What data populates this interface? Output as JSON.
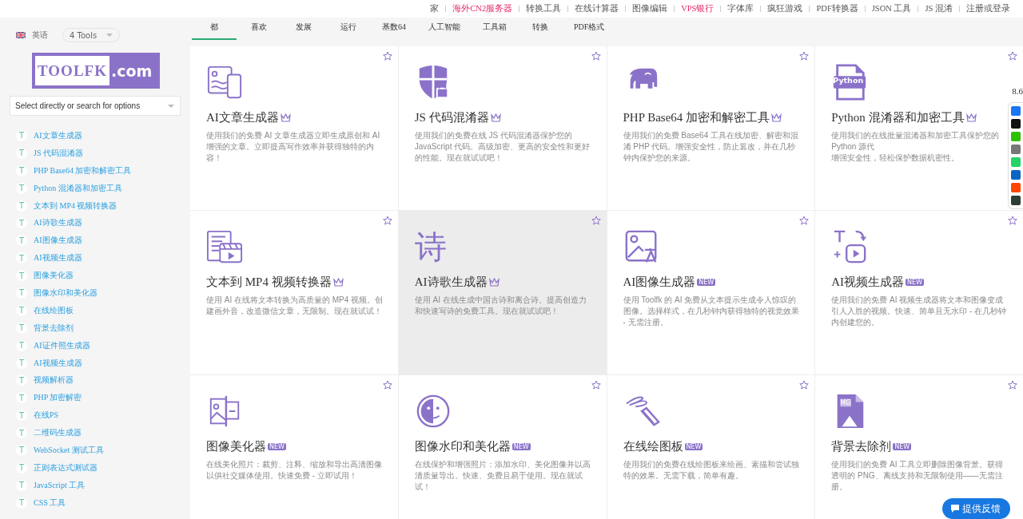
{
  "top_links": [
    {
      "label": "家",
      "highlight": false
    },
    {
      "label": "海外CN2服务器",
      "highlight": true
    },
    {
      "label": "转换工具",
      "highlight": false
    },
    {
      "label": "在线计算器",
      "highlight": false
    },
    {
      "label": "图像编辑",
      "highlight": false
    },
    {
      "label": "VPS银行",
      "highlight": true
    },
    {
      "label": "字体库",
      "highlight": false
    },
    {
      "label": "疯狂游戏",
      "highlight": false
    },
    {
      "label": "PDF转换器",
      "highlight": false
    },
    {
      "label": "JSON 工具",
      "highlight": false
    },
    {
      "label": "JS 混淆",
      "highlight": false
    },
    {
      "label": "注册或登录",
      "highlight": false
    }
  ],
  "sidebar": {
    "language": "英语",
    "tools_dropdown": "4 Tools",
    "logo": {
      "left": "TOOLFK",
      "right": ".com"
    },
    "search": {
      "placeholder": "Select directly or search for options"
    },
    "items": [
      {
        "mark": "T",
        "label": "AI文章生成器"
      },
      {
        "mark": "T",
        "label": "JS 代码混淆器"
      },
      {
        "mark": "T",
        "label": "PHP Base64 加密和解密工具"
      },
      {
        "mark": "T",
        "label": "Python 混淆器和加密工具"
      },
      {
        "mark": "T",
        "label": "文本到 MP4 视频转换器"
      },
      {
        "mark": "T",
        "label": "AI诗歌生成器"
      },
      {
        "mark": "T",
        "label": "AI图像生成器"
      },
      {
        "mark": "T",
        "label": "AI视频生成器"
      },
      {
        "mark": "T",
        "label": "图像美化器"
      },
      {
        "mark": "T",
        "label": "图像水印和美化器"
      },
      {
        "mark": "T",
        "label": "在线绘图板"
      },
      {
        "mark": "T",
        "label": "背景去除剂"
      },
      {
        "mark": "T",
        "label": "AI证件照生成器"
      },
      {
        "mark": "T",
        "label": "AI视频生成器"
      },
      {
        "mark": "T",
        "label": "视频解析器"
      },
      {
        "mark": "T",
        "label": "PHP 加密解密"
      },
      {
        "mark": "T",
        "label": "在线PS"
      },
      {
        "mark": "T",
        "label": "二维码生成器"
      },
      {
        "mark": "T",
        "label": "WebSocket 测试工具"
      },
      {
        "mark": "T",
        "label": "正则表达式测试器"
      },
      {
        "mark": "T",
        "label": "JavaScript 工具"
      },
      {
        "mark": "T",
        "label": "CSS 工具"
      }
    ]
  },
  "tabs": [
    {
      "label": "都",
      "selected": true
    },
    {
      "label": "喜欢",
      "selected": false
    },
    {
      "label": "发展",
      "selected": false
    },
    {
      "label": "运行",
      "selected": false
    },
    {
      "label": "基数64",
      "selected": false
    },
    {
      "label": "人工智能",
      "selected": false
    },
    {
      "label": "工具箱",
      "selected": false
    },
    {
      "label": "转换",
      "selected": false
    },
    {
      "label": "PDF格式",
      "selected": false
    }
  ],
  "cards": [
    {
      "title": "AI文章生成器",
      "badge": {
        "kind": "crown"
      },
      "description": "使用我们的免费 AI 文章生成器立即生成原创和 AI 增强的文章。立即提高写作效率并获得独特的内容！",
      "highlighted": false
    },
    {
      "title": "JS 代码混淆器",
      "badge": {
        "kind": "crown"
      },
      "description": "使用我们的免费在线 JS 代码混淆器保护您的 JavaScript 代码。高级加密、更高的安全性和更好的性能。现在就试试吧！",
      "highlighted": false
    },
    {
      "title": "PHP Base64 加密和解密工具",
      "badge": {
        "kind": "crown"
      },
      "description": "使用我们的免费 Base64 工具在线加密、解密和混淆 PHP 代码。增强安全性，防止篡改，并在几秒钟内保护您的来源。",
      "highlighted": false
    },
    {
      "title": "Python 混淆器和加密工具",
      "badge": {
        "kind": "crown"
      },
      "icon_text": "Python",
      "description": "使用我们的在线批量混淆器和加密工具保护您的 Python 源代",
      "description_2": "增强安全性，轻松保护数据机密性。",
      "highlighted": false
    },
    {
      "title": "文本到 MP4 视频转换器",
      "badge": {
        "kind": "crown"
      },
      "description": "使用 AI 在线将文本转换为高质量的 MP4 视频。创建画外音，改造微信文章，无限制。现在就试试！",
      "highlighted": false
    },
    {
      "title": "AI诗歌生成器",
      "badge": {
        "kind": "crown"
      },
      "icon_text": "诗",
      "description": "使用 AI 在线生成中国古诗和离合诗。提高创造力和快速写诗的免费工具。现在就试试吧！",
      "highlighted": true
    },
    {
      "title": "AI图像生成器",
      "badge": {
        "kind": "new",
        "text": "NEW"
      },
      "description": "使用 Toolfk 的 AI 免费从文本提示生成令人惊叹的图像。选择样式，在几秒钟内获得独特的视觉效果 - 无需注册。",
      "highlighted": false
    },
    {
      "title": "AI视频生成器",
      "badge": {
        "kind": "new",
        "text": "NEW"
      },
      "description": "使用我们的免费 AI 视频生成器将文本和图像变成引人入胜的视频。快速、简单且无水印 - 在几秒钟内创建您的。",
      "highlighted": false
    },
    {
      "title": "图像美化器",
      "badge": {
        "kind": "new",
        "text": "NEW"
      },
      "description": "在线美化照片：裁剪、注释、缩放和导出高清图像以供社交媒体使用。快速免费 - 立即试用！",
      "highlighted": false
    },
    {
      "title": "图像水印和美化器",
      "badge": {
        "kind": "new",
        "text": "NEW"
      },
      "description": "在线保护和增强照片：添加水印、美化图像并以高清质量导出。快速、免费且易于使用。现在就试试！",
      "highlighted": false
    },
    {
      "title": "在线绘图板",
      "badge": {
        "kind": "new",
        "text": "NEW"
      },
      "description": "使用我们的免费在线绘图板来绘画、素描和尝试独特的效果。无需下载，简单有趣。",
      "highlighted": false
    },
    {
      "title": "背景去除剂",
      "badge": {
        "kind": "new",
        "text": "NEW"
      },
      "icon_text": "MG",
      "description": "使用我们的免费 AI 工具立即删除图像背景。获得透明的 PNG、离线支持和无限制使用——无需注册。",
      "highlighted": false
    }
  ],
  "share": {
    "count": "8.6"
  },
  "feedback_button": "提供反馈"
}
